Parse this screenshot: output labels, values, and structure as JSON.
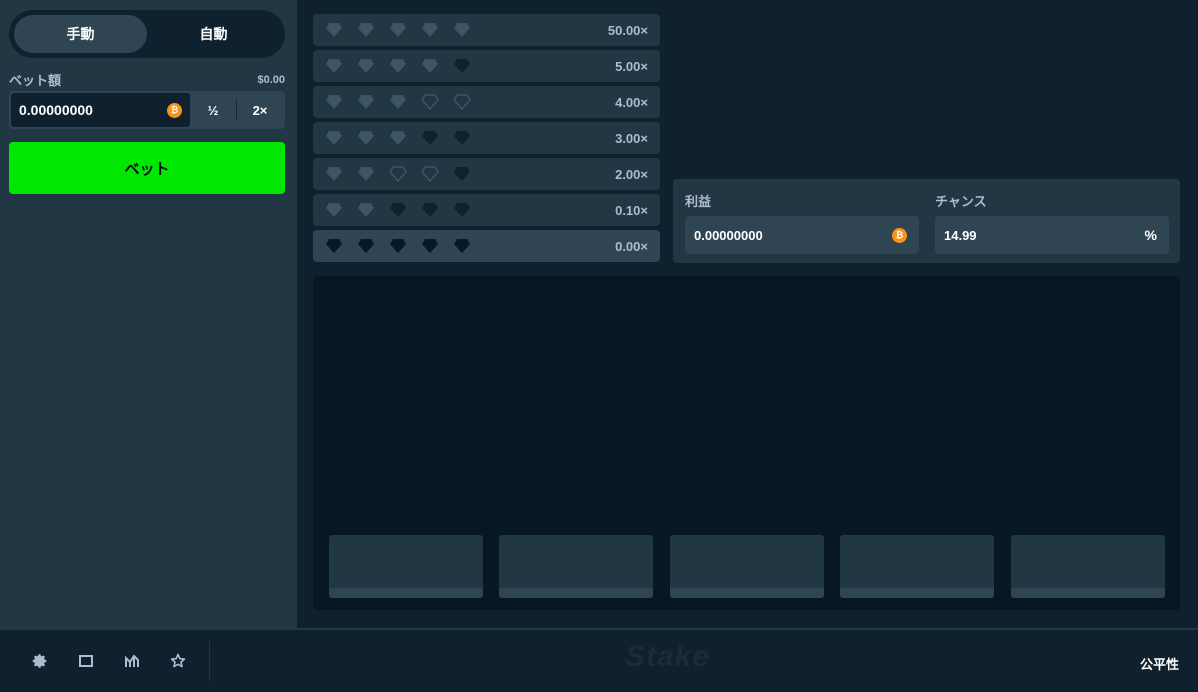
{
  "sidebar": {
    "tabs": [
      {
        "label": "手動",
        "active": true
      },
      {
        "label": "自動",
        "active": false
      }
    ],
    "bet_label": "ベット額",
    "bet_amount_usd": "$0.00",
    "bet_value": "0.00000000",
    "coin_symbol": "₿",
    "half_label": "½",
    "double_label": "2×",
    "bet_button": "ベット"
  },
  "paytable": [
    {
      "multiplier": "50.00×",
      "gems": [
        "filled",
        "filled",
        "filled",
        "filled",
        "filled"
      ],
      "highlight": false
    },
    {
      "multiplier": "5.00×",
      "gems": [
        "filled",
        "filled",
        "filled",
        "filled",
        "dark"
      ],
      "highlight": false
    },
    {
      "multiplier": "4.00×",
      "gems": [
        "filled",
        "filled",
        "filled",
        "outline",
        "outline"
      ],
      "highlight": false
    },
    {
      "multiplier": "3.00×",
      "gems": [
        "filled",
        "filled",
        "filled",
        "dark",
        "dark"
      ],
      "highlight": false
    },
    {
      "multiplier": "2.00×",
      "gems": [
        "filled",
        "filled",
        "outline",
        "outline",
        "dark"
      ],
      "highlight": false
    },
    {
      "multiplier": "0.10×",
      "gems": [
        "filled",
        "filled",
        "dark",
        "dark",
        "dark"
      ],
      "highlight": false
    },
    {
      "multiplier": "0.00×",
      "gems": [
        "black",
        "black",
        "black",
        "black",
        "black"
      ],
      "highlight": true
    }
  ],
  "stats": {
    "profit_label": "利益",
    "profit_value": "0.00000000",
    "chance_label": "チャンス",
    "chance_value": "14.99",
    "chance_unit": "%"
  },
  "colors": {
    "gem_filled": "#3d5564",
    "gem_dark": "#0f212e",
    "gem_black": "#071824",
    "gem_outline": "#3d5564",
    "accent_green": "#00e701"
  },
  "footer": {
    "icons": [
      "gear-icon",
      "square-icon",
      "stats-icon",
      "star-icon"
    ],
    "brand": "Stake",
    "fairness": "公平性"
  }
}
